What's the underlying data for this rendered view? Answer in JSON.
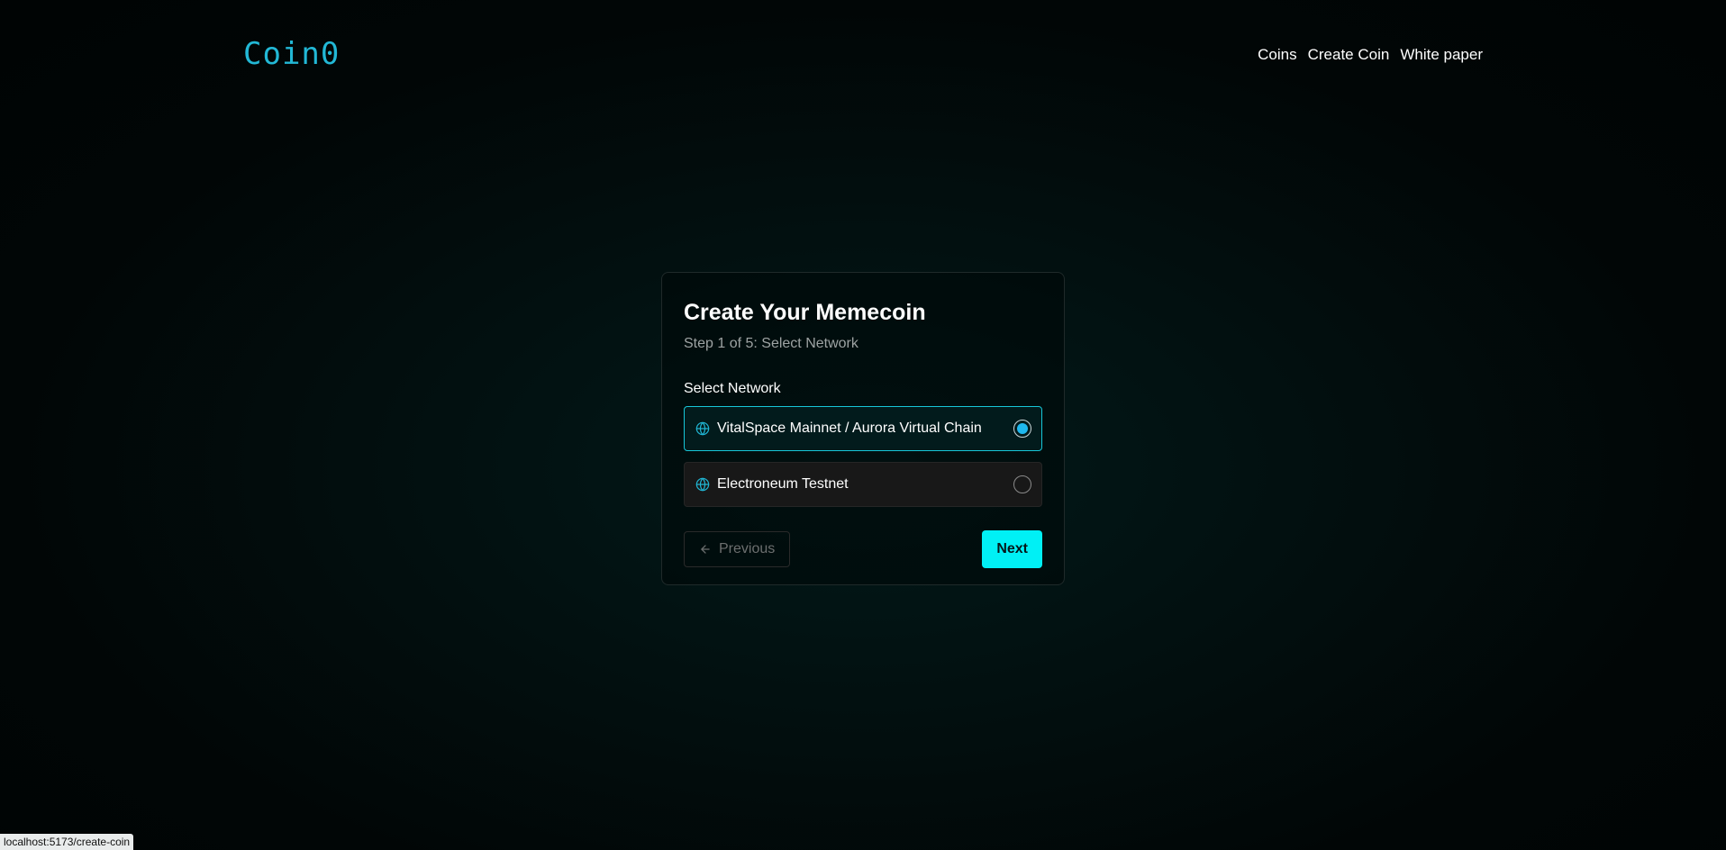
{
  "header": {
    "logo": "Coin0",
    "nav": [
      {
        "label": "Coins"
      },
      {
        "label": "Create Coin"
      },
      {
        "label": "White paper"
      }
    ]
  },
  "card": {
    "title": "Create Your Memecoin",
    "subtitle": "Step 1 of 5: Select Network",
    "section_label": "Select Network",
    "options": [
      {
        "label": "VitalSpace Mainnet / Aurora Virtual Chain",
        "selected": true,
        "icon": "globe-icon"
      },
      {
        "label": "Electroneum Testnet",
        "selected": false,
        "icon": "globe-icon"
      }
    ],
    "previous_label": "Previous",
    "next_label": "Next"
  },
  "status_bar": {
    "url": "localhost:5173/create-coin"
  },
  "colors": {
    "accent": "#00f0f5",
    "logo": "#22b8d6",
    "radio_dot": "#1fb8ee"
  }
}
